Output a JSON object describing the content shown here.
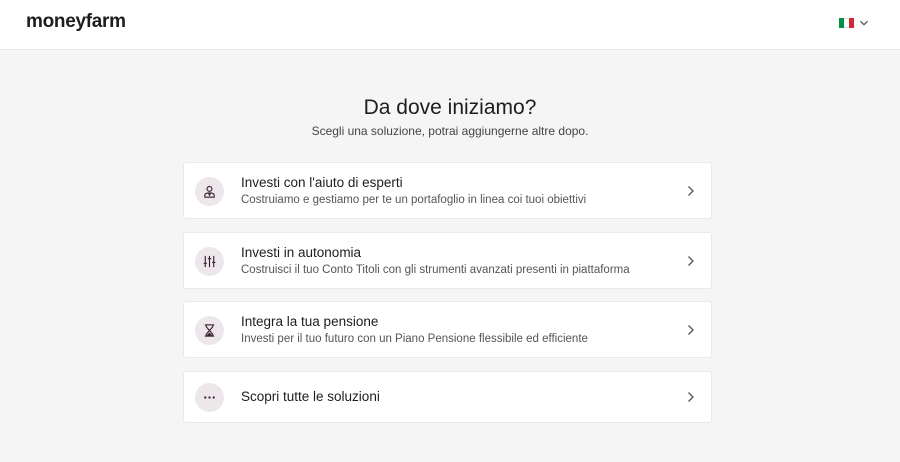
{
  "header": {
    "logo": "moneyfarm",
    "language": {
      "flag_colors": [
        "#009246",
        "#ffffff",
        "#ce2b37"
      ]
    }
  },
  "main": {
    "title": "Da dove iniziamo?",
    "subtitle": "Scegli una soluzione, potrai aggiungerne altre dopo.",
    "options": [
      {
        "title": "Investi con l'aiuto di esperti",
        "description": "Costruiamo e gestiamo per te un portafoglio in linea coi tuoi obiettivi",
        "icon": "advisor-icon"
      },
      {
        "title": "Investi in autonomia",
        "description": "Costruisci il tuo Conto Titoli con gli strumenti avanzati presenti in piattaforma",
        "icon": "sliders-icon"
      },
      {
        "title": "Integra la tua pensione",
        "description": "Investi per il tuo futuro con un Piano Pensione flessibile ed efficiente",
        "icon": "hourglass-icon"
      },
      {
        "title": "Scopri tutte le soluzioni",
        "icon": "more-icon"
      }
    ]
  },
  "colors": {
    "background": "#f5f5f5",
    "icon_circle": "#ede6ea",
    "icon_stroke": "#3a2030"
  }
}
